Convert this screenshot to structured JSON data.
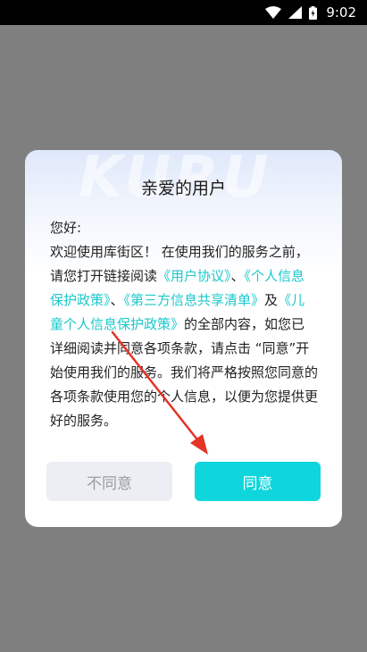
{
  "status_bar": {
    "time": "9:02",
    "icons": [
      "wifi-icon",
      "cellular-signal-icon",
      "battery-icon"
    ]
  },
  "dialog": {
    "watermark": "KURU",
    "title": "亲爱的用户",
    "greeting": "您好:",
    "body_parts": [
      "欢迎使用库街区！ 在使用我们的服务之前，请您打开链接阅读",
      "《用户协议》",
      "、",
      "《个人信息保护政策》",
      "、",
      "《第三方信息共享清单》",
      "及",
      "《儿童个人信息保护政策》",
      "的全部内容，如您已详细阅读并同意各项条款，请点击 “同意”开始使用我们的服务。我们将严格按照您同意的各项条款使用您的个人信息，以便为您提供更好的服务。"
    ],
    "disagree_label": "不同意",
    "agree_label": "同意"
  },
  "colors": {
    "overlay": "#7f7f7f",
    "link": "#1cc8cc",
    "agree_button": "#0ed6dc",
    "disagree_button": "#eceef3",
    "annotation_arrow": "#e53325"
  }
}
